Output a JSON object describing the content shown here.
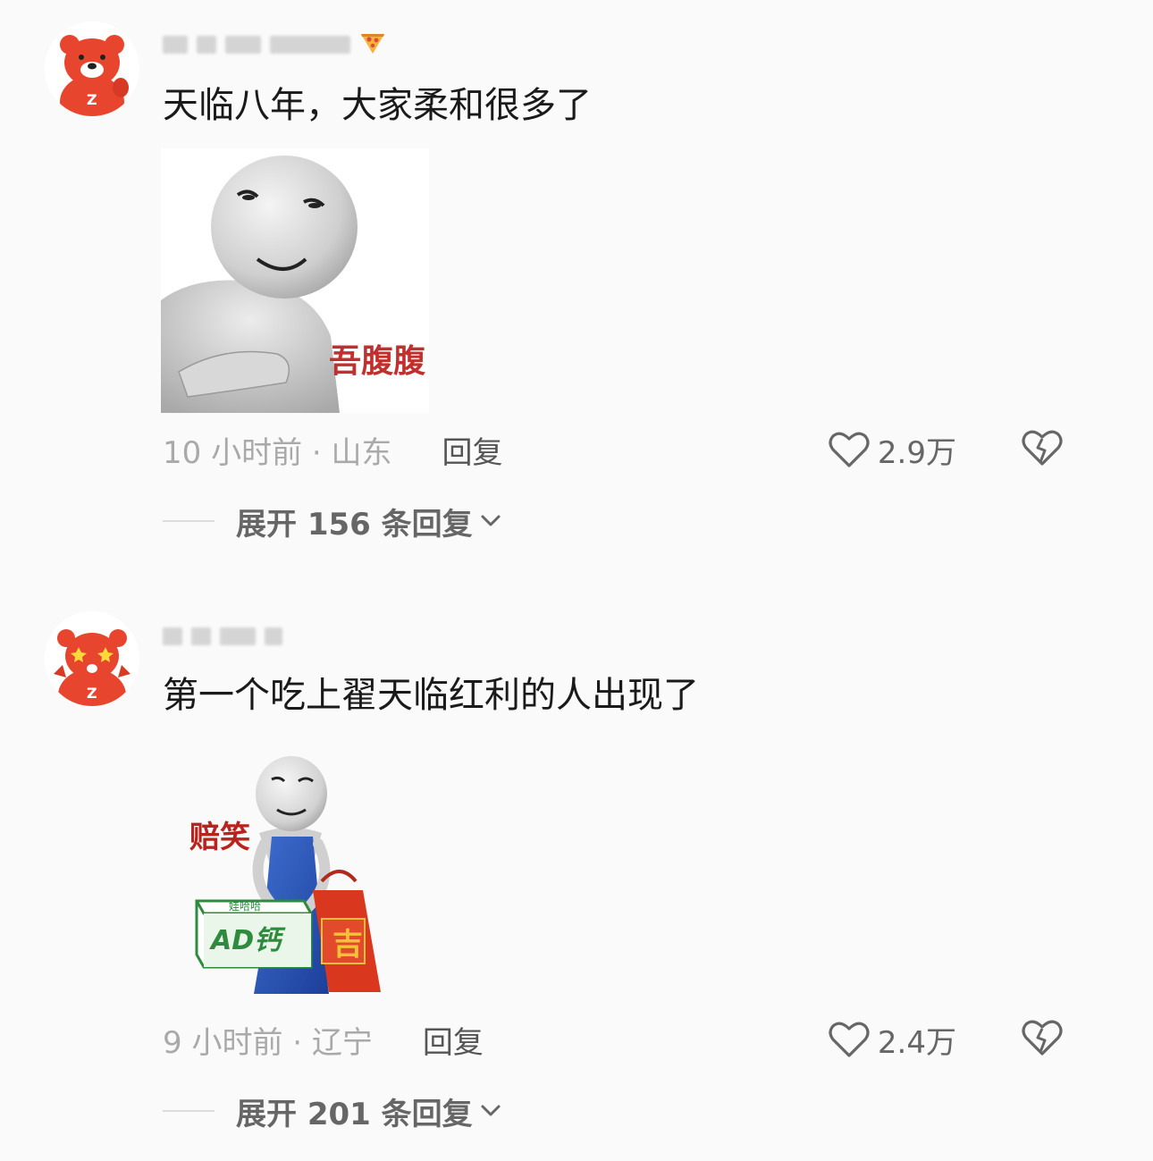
{
  "comments": [
    {
      "username": "",
      "text": "天临八年，大家柔和很多了",
      "sticker_caption": "吾腹腹",
      "time_location": "10 小时前 · 山东",
      "reply_label": "回复",
      "like_count": "2.9万",
      "expand_label": "展开 156 条回复",
      "accent_color": "#c0302f"
    },
    {
      "username": "",
      "text": "第一个吃上翟天临红利的人出现了",
      "sticker_caption": "赔笑",
      "box_label": "AD钙",
      "box_brand": "娃哈哈",
      "bag_label": "吉",
      "time_location": "9 小时前 · 辽宁",
      "reply_label": "回复",
      "like_count": "2.4万",
      "expand_label": "展开 201 条回复",
      "accent_color": "#c0302f"
    }
  ],
  "icons": {
    "like": "heart-outline-icon",
    "dislike": "broken-heart-icon",
    "expand": "chevron-down-icon"
  },
  "colors": {
    "avatar_red": "#e8452f",
    "meta_gray": "#a9a9a9",
    "background": "#fafafa"
  }
}
